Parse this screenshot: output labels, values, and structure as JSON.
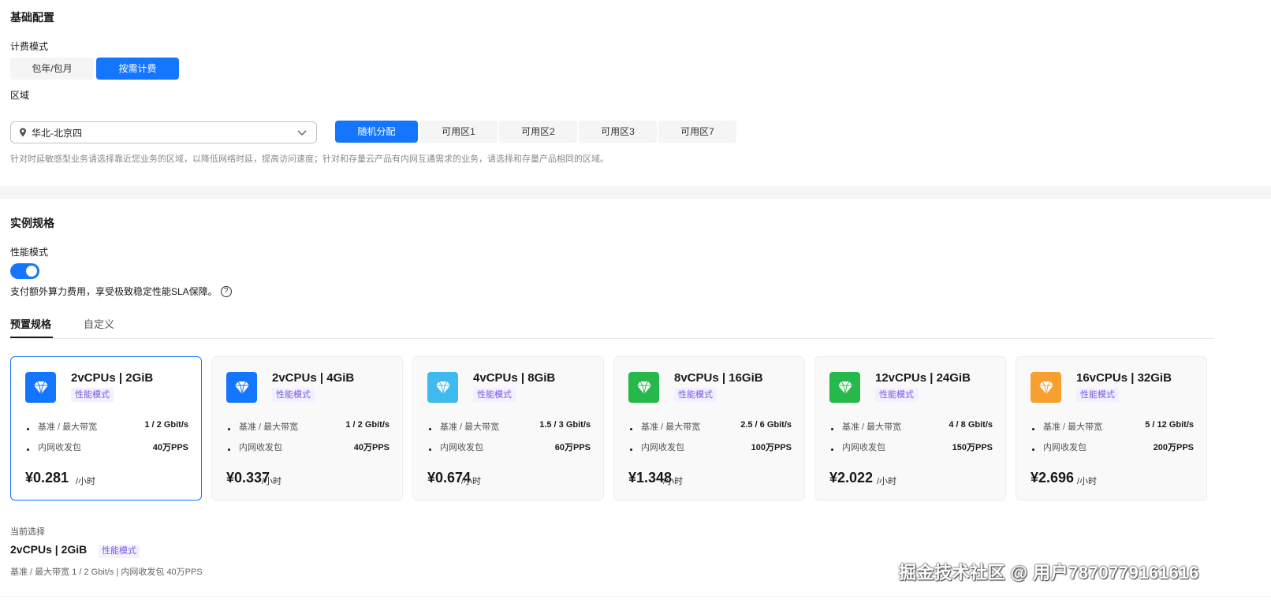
{
  "basic": {
    "title": "基础配置",
    "billing_label": "计费模式",
    "billing_options": [
      "包年/包月",
      "按需计费"
    ],
    "billing_selected": "按需计费",
    "region_label": "区域",
    "region_value": "华北-北京四",
    "zone_options": [
      "随机分配",
      "可用区1",
      "可用区2",
      "可用区3",
      "可用区7"
    ],
    "zone_selected": "随机分配",
    "hint": "针对时延敏感型业务请选择靠近您业务的区域，以降低网络时延，提高访问速度；针对和存量云产品有内网互通需求的业务，请选择和存量产品相同的区域。"
  },
  "instance": {
    "title": "实例规格",
    "perf_label": "性能模式",
    "perf_enabled": true,
    "perf_desc": "支付额外算力费用，享受极致稳定性能SLA保障。",
    "help_icon": "question-circle-icon",
    "tabs": [
      "预置规格",
      "自定义"
    ],
    "active_tab": "预置规格",
    "row_labels": {
      "bandwidth": "基准 / 最大带宽",
      "pps": "内网收发包"
    },
    "cards": [
      {
        "spec": "2vCPUs | 2GiB",
        "mode": "性能模式",
        "bandwidth": "1 / 2 Gbit/s",
        "pps": "40万PPS",
        "price": "¥0.281",
        "unit": "/小时",
        "color": "#1476ff",
        "icon": "diamond-icon"
      },
      {
        "spec": "2vCPUs | 4GiB",
        "mode": "性能模式",
        "bandwidth": "1 / 2 Gbit/s",
        "pps": "40万PPS",
        "price": "¥0.337",
        "unit": "/小时",
        "color": "#1476ff",
        "icon": "diamond-icon"
      },
      {
        "spec": "4vCPUs | 8GiB",
        "mode": "性能模式",
        "bandwidth": "1.5 / 3 Gbit/s",
        "pps": "60万PPS",
        "price": "¥0.674",
        "unit": "/小时",
        "color": "#3fb9f0",
        "icon": "gem-icon"
      },
      {
        "spec": "8vCPUs | 16GiB",
        "mode": "性能模式",
        "bandwidth": "2.5 / 6 Gbit/s",
        "pps": "100万PPS",
        "price": "¥1.348",
        "unit": "/小时",
        "color": "#26b84a",
        "icon": "gem-icon"
      },
      {
        "spec": "12vCPUs | 24GiB",
        "mode": "性能模式",
        "bandwidth": "4 / 8 Gbit/s",
        "pps": "150万PPS",
        "price": "¥2.022",
        "unit": "/小时",
        "color": "#26b84a",
        "icon": "gem-icon"
      },
      {
        "spec": "16vCPUs | 32GiB",
        "mode": "性能模式",
        "bandwidth": "5 / 12 Gbit/s",
        "pps": "200万PPS",
        "price": "¥2.696",
        "unit": "/小时",
        "color": "#f7a030",
        "icon": "gem-icon"
      }
    ],
    "selected_index": 0
  },
  "current": {
    "label": "当前选择",
    "spec": "2vCPUs | 2GiB",
    "mode": "性能模式",
    "detail": "基准 / 最大带宽  1 / 2 Gbit/s  |  内网收发包  40万PPS"
  },
  "watermark": "掘金技术社区 @ 用户7870779161616"
}
